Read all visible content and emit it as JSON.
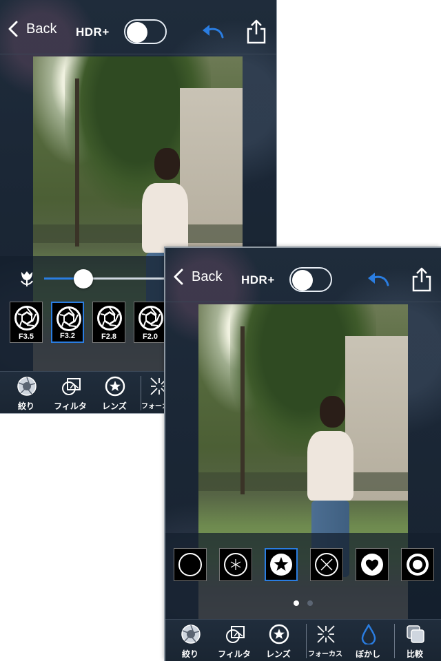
{
  "colors": {
    "accent": "#2a7de1",
    "text": "#ffffff"
  },
  "nav": {
    "back_label": "Back",
    "hdr_label": "HDR+",
    "hdr_enabled": false
  },
  "screen1": {
    "slider_fraction": 0.17,
    "apertures": [
      {
        "label": "F3.5",
        "selected": false
      },
      {
        "label": "F3.2",
        "selected": true
      },
      {
        "label": "F2.8",
        "selected": false
      },
      {
        "label": "F2.0",
        "selected": false
      }
    ]
  },
  "screen2": {
    "shapes": [
      "circle",
      "snowflake",
      "star",
      "cross",
      "heart",
      "dot"
    ],
    "selected_shape": "star",
    "pages": 2,
    "current_page": 1
  },
  "toolbar": {
    "items": [
      {
        "id": "aperture",
        "label": "絞り",
        "icon": "aperture-icon"
      },
      {
        "id": "filter",
        "label": "フィルタ",
        "icon": "filter-icon"
      },
      {
        "id": "lens",
        "label": "レンズ",
        "icon": "lens-star-icon"
      },
      {
        "id": "focus",
        "label": "フォーカス",
        "icon": "focus-icon"
      },
      {
        "id": "blur",
        "label": "ぼかし",
        "icon": "droplet-icon"
      },
      {
        "id": "compare",
        "label": "比較",
        "icon": "compare-icon"
      }
    ]
  }
}
